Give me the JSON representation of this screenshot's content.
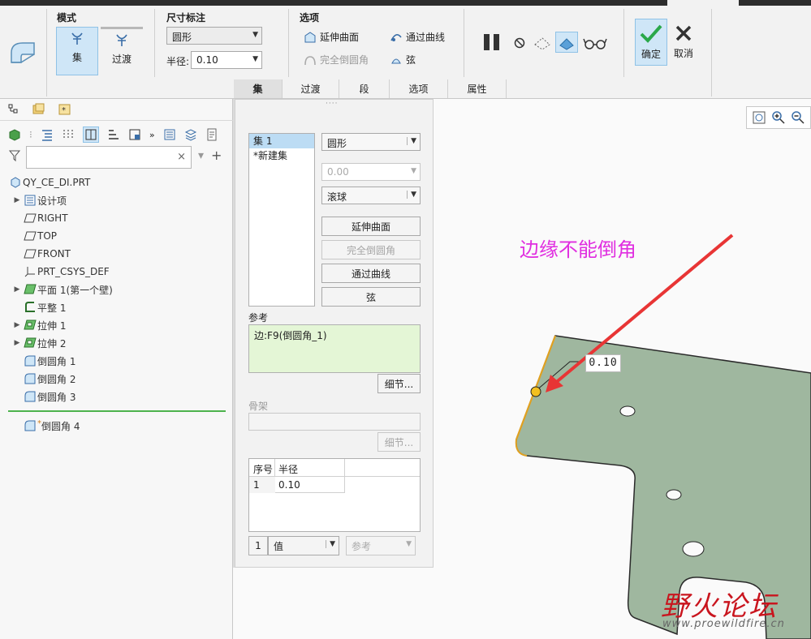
{
  "ribbon": {
    "mode_label": "模式",
    "mode_set": "集",
    "mode_transition": "过渡",
    "dim_label": "尺寸标注",
    "shape_value": "圆形",
    "radius_label": "半径:",
    "radius_value": "0.10",
    "options_label": "选项",
    "opt_extend_surface": "延伸曲面",
    "opt_through_curve": "通过曲线",
    "opt_full_round": "完全倒圆角",
    "opt_chord": "弦",
    "ok_label": "确定",
    "cancel_label": "取消"
  },
  "bottom_tabs": [
    "集",
    "过渡",
    "段",
    "选项",
    "属性"
  ],
  "tree": {
    "root": "QY_CE_DI.PRT",
    "items": [
      "设计项",
      "RIGHT",
      "TOP",
      "FRONT",
      "PRT_CSYS_DEF",
      "平面 1(第一个壁)",
      "平整 1",
      "拉伸 1",
      "拉伸 2",
      "倒圆角 1",
      "倒圆角 2",
      "倒圆角 3"
    ],
    "new_item": "倒圆角 4"
  },
  "dialog": {
    "dots": "····",
    "set_list": [
      "集 1",
      "*新建集"
    ],
    "shape_select": "圆形",
    "value_select": "0.00",
    "method_select": "滚球",
    "btn_extend": "延伸曲面",
    "btn_full_round": "完全倒圆角",
    "btn_through_curve": "通过曲线",
    "btn_chord": "弦",
    "ref_label": "参考",
    "ref_value": "边:F9(倒圆角_1)",
    "detail_btn": "细节...",
    "skeleton_label": "骨架",
    "detail_btn2": "细节...",
    "table_headers": [
      "序号",
      "半径"
    ],
    "table_row": [
      "1",
      "0.10"
    ],
    "bottom_num": "1",
    "bottom_value_select": "值",
    "bottom_ref_select": "参考"
  },
  "graphics": {
    "annotation": "边缘不能倒角",
    "dim_label": "0.10",
    "watermark_main": "野火论坛",
    "watermark_url": "www.proewildfire.cn"
  },
  "colors": {
    "annotation": "#e02ee0",
    "arrow": "#e83535",
    "part_fill": "#9fb79f",
    "edge_highlight": "#e0a020",
    "watermark": "#c9151e"
  }
}
